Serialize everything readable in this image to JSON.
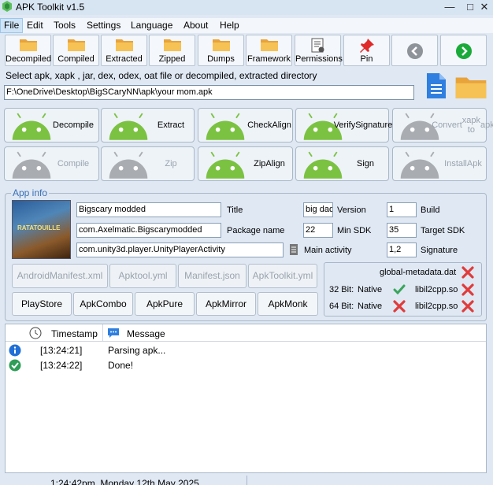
{
  "window": {
    "title": "APK Toolkit v1.5",
    "minimize": "—",
    "maximize": "□",
    "close": "✕"
  },
  "menu": [
    "File",
    "Edit",
    "Tools",
    "Settings",
    "Language",
    "About",
    "Help"
  ],
  "toolbar": {
    "decompiled": "Decompiled",
    "compiled": "Compiled",
    "extracted": "Extracted",
    "zipped": "Zipped",
    "dumps": "Dumps",
    "framework": "Framework",
    "permissions": "Permissions",
    "pin": "Pin"
  },
  "select_label": "Select apk, xapk , jar, dex, odex, oat file or decompiled, extracted directory",
  "path_value": "F:\\OneDrive\\Desktop\\BigSCaryNN\\apk\\your mom.apk",
  "actions": {
    "decompile": "Decompile",
    "extract": "Extract",
    "check_align": [
      "Check",
      "Align"
    ],
    "verify_signature": [
      "Verify",
      "Signature"
    ],
    "convert_xapk": [
      "Convert",
      "xapk to",
      "apk"
    ],
    "compile": "Compile",
    "zip": "Zip",
    "zip_align": [
      "Zip",
      "Align"
    ],
    "sign": "Sign",
    "install_apk": [
      "Install",
      "Apk"
    ]
  },
  "app_info": {
    "legend": "App info",
    "poster_text": "RATATOUILLE",
    "title_value": "Bigscary modded",
    "title_label": "Title",
    "package_value": "com.Axelmatic.Bigscarymodded",
    "package_label": "Package name",
    "activity_value": "com.unity3d.player.UnityPlayerActivity",
    "activity_label": "Main activity",
    "version_value": "big dad",
    "version_label": "Version",
    "build_value": "1",
    "build_label": "Build",
    "minsdk_value": "22",
    "minsdk_label": "Min SDK",
    "targetsdk_value": "35",
    "targetsdk_label": "Target SDK",
    "signature_value": "1,2",
    "signature_label": "Signature"
  },
  "file_buttons": [
    "AndroidManifest.xml",
    "Apktool.yml",
    "Manifest.json",
    "ApkToolkit.yml"
  ],
  "store_buttons": [
    "PlayStore",
    "ApkCombo",
    "ApkPure",
    "ApkMirror",
    "ApkMonk"
  ],
  "libs": {
    "global_metadata": "global-metadata.dat",
    "bit32": "32 Bit:",
    "bit64": "64 Bit:",
    "native": "Native",
    "lib_name": "libil2cpp.so"
  },
  "log": {
    "col_timestamp": "Timestamp",
    "col_message": "Message",
    "rows": [
      {
        "type": "info",
        "time": "[13:24:21]",
        "message": "Parsing apk..."
      },
      {
        "type": "success",
        "time": "[13:24:22]",
        "message": "Done!"
      }
    ]
  },
  "status_bar": "1:24:42pm, Monday 12th May 2025",
  "colors": {
    "accent": "#3a6fb5",
    "android_green": "#7cc242",
    "error_red": "#e03b3b",
    "success_green": "#2f9e57"
  }
}
